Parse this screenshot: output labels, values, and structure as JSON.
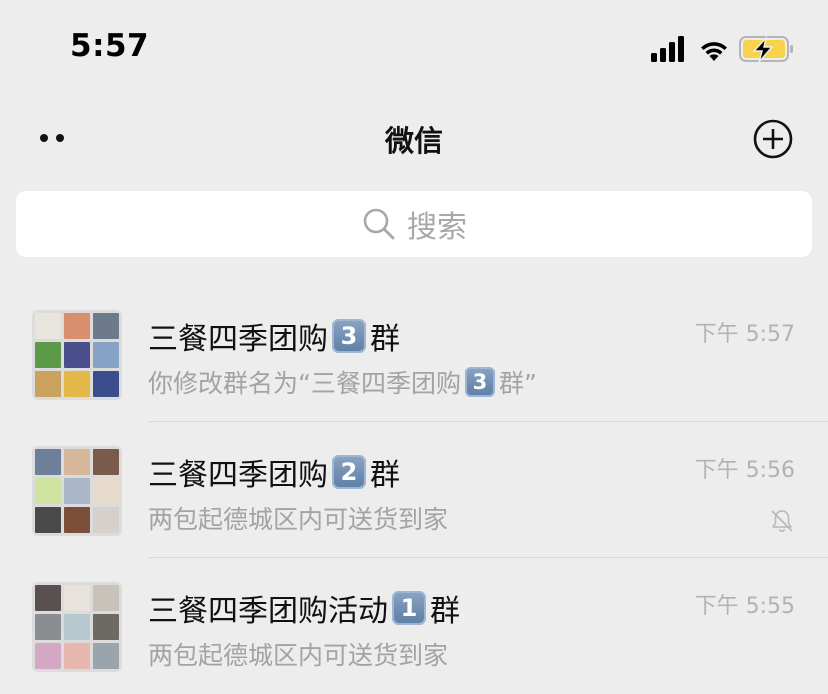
{
  "status_bar": {
    "time": "5:57",
    "signal_icon": "cellular-signal-icon",
    "wifi_icon": "wifi-icon",
    "battery_icon": "battery-charging-icon",
    "battery_color": "#f7d24a"
  },
  "nav": {
    "title": "微信",
    "more_icon": "more-dots-icon",
    "add_icon": "add-circle-icon"
  },
  "search": {
    "placeholder": "搜索",
    "icon": "search-icon"
  },
  "chats": [
    {
      "title_prefix": "三餐四季团购",
      "title_badge": "3",
      "title_suffix": "群",
      "preview_prefix": "你修改群名为“三餐四季团购",
      "preview_badge": "3",
      "preview_suffix": "群”",
      "time": "下午 5:57",
      "muted": false,
      "avatar_colors": [
        "#e9e4dc",
        "#d98e6e",
        "#6c7a8c",
        "#5c9a4a",
        "#4a4f8c",
        "#86a3c7",
        "#c9a25d",
        "#e3b84a",
        "#3b4d8c"
      ]
    },
    {
      "title_prefix": "三餐四季团购",
      "title_badge": "2",
      "title_suffix": "群",
      "preview_prefix": "两包起德城区内可送货到家",
      "preview_badge": "",
      "preview_suffix": "",
      "time": "下午 5:56",
      "muted": true,
      "avatar_colors": [
        "#6e7f9a",
        "#d7b79a",
        "#7a5a4a",
        "#cfe3a0",
        "#a9b7c8",
        "#e7dccb",
        "#4a4a4a",
        "#7b4f3a",
        "#d6d0cc"
      ]
    },
    {
      "title_prefix": "三餐四季团购活动",
      "title_badge": "1",
      "title_suffix": "群",
      "preview_prefix": "两包起德城区内可送货到家",
      "preview_badge": "",
      "preview_suffix": "",
      "time": "下午 5:55",
      "muted": false,
      "avatar_colors": [
        "#5a5050",
        "#e7e2dc",
        "#c9c2bb",
        "#8a8e92",
        "#b7c9cf",
        "#6d6a66",
        "#d4a8c4",
        "#e6b8b0",
        "#9aa4ac"
      ]
    }
  ]
}
